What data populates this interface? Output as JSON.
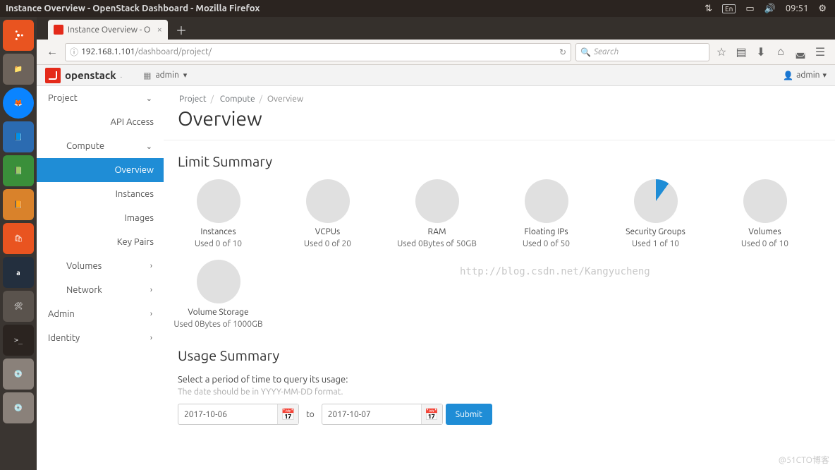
{
  "ubuntu_title": "Instance Overview - OpenStack Dashboard - Mozilla Firefox",
  "ubuntu_clock": "09:51",
  "ubuntu_lang": "En",
  "tab_title": "Instance Overview - O",
  "address": {
    "host": "192.168.1.101",
    "path": "/dashboard/project/"
  },
  "search_placeholder": "Search",
  "brand": "openstack",
  "project_dropdown": "admin",
  "user_dropdown": "admin",
  "sidebar": {
    "project": "Project",
    "api_access": "API Access",
    "compute": "Compute",
    "compute_items": {
      "overview": "Overview",
      "instances": "Instances",
      "images": "Images",
      "key_pairs": "Key Pairs"
    },
    "volumes": "Volumes",
    "network": "Network",
    "admin": "Admin",
    "identity": "Identity"
  },
  "crumbs": {
    "project": "Project",
    "compute": "Compute",
    "overview": "Overview"
  },
  "page_title": "Overview",
  "limit_section": "Limit Summary",
  "limits": [
    {
      "name": "Instances",
      "used": "Used 0 of 10",
      "pct": 0
    },
    {
      "name": "VCPUs",
      "used": "Used 0 of 20",
      "pct": 0
    },
    {
      "name": "RAM",
      "used": "Used 0Bytes of 50GB",
      "pct": 0
    },
    {
      "name": "Floating IPs",
      "used": "Used 0 of 50",
      "pct": 0
    },
    {
      "name": "Security Groups",
      "used": "Used 1 of 10",
      "pct": 10
    },
    {
      "name": "Volumes",
      "used": "Used 0 of 10",
      "pct": 0
    },
    {
      "name": "Volume Storage",
      "used": "Used 0Bytes of 1000GB",
      "pct": 0
    }
  ],
  "usage_section": "Usage Summary",
  "usage_prompt": "Select a period of time to query its usage:",
  "usage_hint": "The date should be in YYYY-MM-DD format.",
  "date_from": "2017-10-06",
  "date_to": "2017-10-07",
  "to_label": "to",
  "submit_label": "Submit",
  "watermark": "http://blog.csdn.net/Kangyucheng",
  "corner_watermark": "@51CTO博客",
  "chart_data": {
    "type": "pie",
    "series": [
      {
        "name": "Instances",
        "used": 0,
        "total": 10
      },
      {
        "name": "VCPUs",
        "used": 0,
        "total": 20
      },
      {
        "name": "RAM",
        "used_bytes": 0,
        "total": "50GB"
      },
      {
        "name": "Floating IPs",
        "used": 0,
        "total": 50
      },
      {
        "name": "Security Groups",
        "used": 1,
        "total": 10
      },
      {
        "name": "Volumes",
        "used": 0,
        "total": 10
      },
      {
        "name": "Volume Storage",
        "used_bytes": 0,
        "total": "1000GB"
      }
    ]
  }
}
